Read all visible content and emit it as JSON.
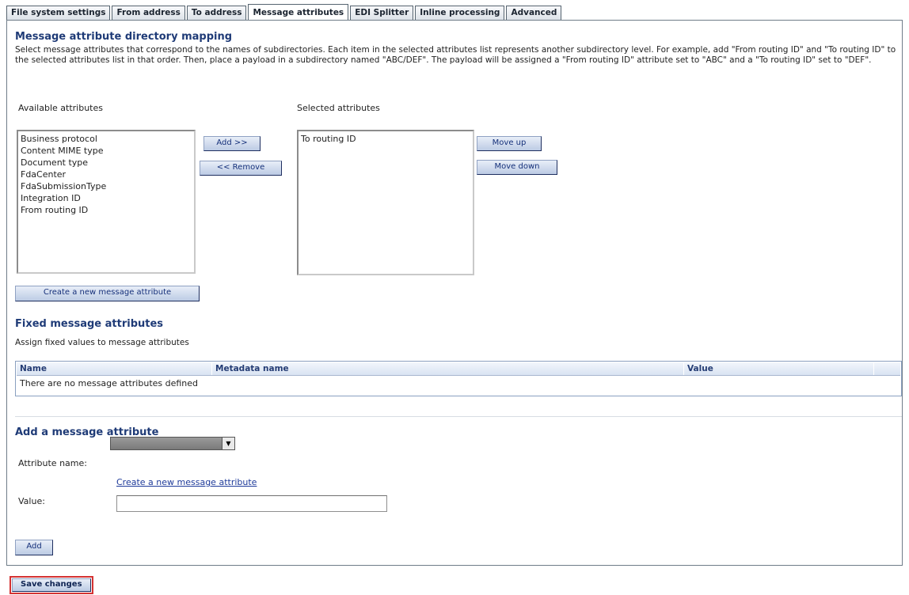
{
  "tabs": [
    {
      "label": "File system settings"
    },
    {
      "label": "From address"
    },
    {
      "label": "To address"
    },
    {
      "label": "Message attributes",
      "active": true
    },
    {
      "label": "EDI Splitter"
    },
    {
      "label": "Inline processing"
    },
    {
      "label": "Advanced"
    }
  ],
  "mapping": {
    "title": "Message attribute directory mapping",
    "description": "Select message attributes that correspond to the names of subdirectories. Each item in the selected attributes list represents another subdirectory level. For example, add \"From routing ID\" and \"To routing ID\" to the selected attributes list in that order. Then, place a payload in a subdirectory named \"ABC/DEF\". The payload will be assigned a \"From routing ID\" attribute set to \"ABC\" and a \"To routing ID\" set to \"DEF\".",
    "available_label": "Available attributes",
    "selected_label": "Selected attributes",
    "available": [
      "Business protocol",
      "Content MIME type",
      "Document type",
      "FdaCenter",
      "FdaSubmissionType",
      "Integration ID",
      "From routing ID"
    ],
    "selected": [
      "To routing ID"
    ],
    "add_button": "Add >>",
    "remove_button": "<< Remove",
    "move_up_button": "Move up",
    "move_down_button": "Move down",
    "create_button": "Create a new message attribute"
  },
  "fixed": {
    "title": "Fixed message attributes",
    "subtitle": "Assign fixed values to message attributes",
    "columns": [
      "Name",
      "Metadata name",
      "Value"
    ],
    "empty_text": "There are no message attributes defined"
  },
  "add_attr": {
    "title": "Add a message attribute",
    "name_label": "Attribute name:",
    "create_link": "Create a new message attribute",
    "value_label": "Value:",
    "value": "",
    "add_button": "Add"
  },
  "footer": {
    "save_button": "Save changes"
  },
  "colors": {
    "heading": "#1f3b77",
    "button_text": "#15307a",
    "highlight_border": "#d43232"
  }
}
